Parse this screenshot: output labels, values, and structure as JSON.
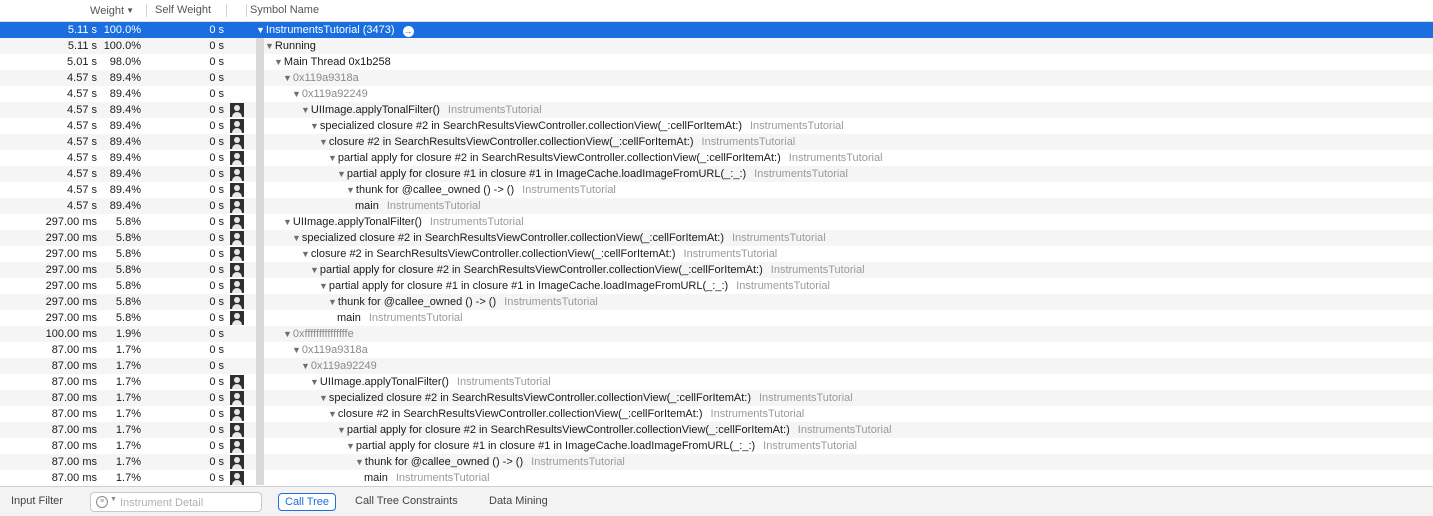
{
  "header": {
    "weight": "Weight",
    "self_weight": "Self Weight",
    "symbol_name": "Symbol Name"
  },
  "rows": [
    {
      "time": "5.11 s",
      "pct": "100.0%",
      "self": "0 s",
      "avatar": false,
      "depth": 0,
      "symbol": "InstrumentsTutorial (3473)",
      "lib": "",
      "expanded": true,
      "selected": true,
      "address": false,
      "go_icon": true
    },
    {
      "time": "5.11 s",
      "pct": "100.0%",
      "self": "0 s",
      "avatar": false,
      "depth": 1,
      "symbol": "Running",
      "lib": "",
      "expanded": true,
      "address": false
    },
    {
      "time": "5.01 s",
      "pct": "98.0%",
      "self": "0 s",
      "avatar": false,
      "depth": 2,
      "symbol": "Main Thread  0x1b258",
      "lib": "",
      "expanded": true,
      "address": false
    },
    {
      "time": "4.57 s",
      "pct": "89.4%",
      "self": "0 s",
      "avatar": false,
      "depth": 3,
      "symbol": "0x119a9318a",
      "lib": "",
      "expanded": true,
      "address": true
    },
    {
      "time": "4.57 s",
      "pct": "89.4%",
      "self": "0 s",
      "avatar": false,
      "depth": 4,
      "symbol": "0x119a92249",
      "lib": "",
      "expanded": true,
      "address": true
    },
    {
      "time": "4.57 s",
      "pct": "89.4%",
      "self": "0 s",
      "avatar": true,
      "depth": 5,
      "symbol": "UIImage.applyTonalFilter()",
      "lib": "InstrumentsTutorial",
      "expanded": true,
      "address": false
    },
    {
      "time": "4.57 s",
      "pct": "89.4%",
      "self": "0 s",
      "avatar": true,
      "depth": 6,
      "symbol": "specialized closure #2 in SearchResultsViewController.collectionView(_:cellForItemAt:)",
      "lib": "InstrumentsTutorial",
      "expanded": true,
      "address": false
    },
    {
      "time": "4.57 s",
      "pct": "89.4%",
      "self": "0 s",
      "avatar": true,
      "depth": 7,
      "symbol": "closure #2 in SearchResultsViewController.collectionView(_:cellForItemAt:)",
      "lib": "InstrumentsTutorial",
      "expanded": true,
      "address": false
    },
    {
      "time": "4.57 s",
      "pct": "89.4%",
      "self": "0 s",
      "avatar": true,
      "depth": 8,
      "symbol": "partial apply for closure #2 in SearchResultsViewController.collectionView(_:cellForItemAt:)",
      "lib": "InstrumentsTutorial",
      "expanded": true,
      "address": false
    },
    {
      "time": "4.57 s",
      "pct": "89.4%",
      "self": "0 s",
      "avatar": true,
      "depth": 9,
      "symbol": "partial apply for closure #1 in closure #1 in ImageCache.loadImageFromURL(_:_:)",
      "lib": "InstrumentsTutorial",
      "expanded": true,
      "address": false
    },
    {
      "time": "4.57 s",
      "pct": "89.4%",
      "self": "0 s",
      "avatar": true,
      "depth": 10,
      "symbol": "thunk for @callee_owned () -> ()",
      "lib": "InstrumentsTutorial",
      "expanded": true,
      "address": false
    },
    {
      "time": "4.57 s",
      "pct": "89.4%",
      "self": "0 s",
      "avatar": true,
      "depth": 11,
      "symbol": "main",
      "lib": "InstrumentsTutorial",
      "expanded": false,
      "address": false
    },
    {
      "time": "297.00 ms",
      "pct": "5.8%",
      "self": "0 s",
      "avatar": true,
      "depth": 3,
      "symbol": "UIImage.applyTonalFilter()",
      "lib": "InstrumentsTutorial",
      "expanded": true,
      "address": false
    },
    {
      "time": "297.00 ms",
      "pct": "5.8%",
      "self": "0 s",
      "avatar": true,
      "depth": 4,
      "symbol": "specialized closure #2 in SearchResultsViewController.collectionView(_:cellForItemAt:)",
      "lib": "InstrumentsTutorial",
      "expanded": true,
      "address": false
    },
    {
      "time": "297.00 ms",
      "pct": "5.8%",
      "self": "0 s",
      "avatar": true,
      "depth": 5,
      "symbol": "closure #2 in SearchResultsViewController.collectionView(_:cellForItemAt:)",
      "lib": "InstrumentsTutorial",
      "expanded": true,
      "address": false
    },
    {
      "time": "297.00 ms",
      "pct": "5.8%",
      "self": "0 s",
      "avatar": true,
      "depth": 6,
      "symbol": "partial apply for closure #2 in SearchResultsViewController.collectionView(_:cellForItemAt:)",
      "lib": "InstrumentsTutorial",
      "expanded": true,
      "address": false
    },
    {
      "time": "297.00 ms",
      "pct": "5.8%",
      "self": "0 s",
      "avatar": true,
      "depth": 7,
      "symbol": "partial apply for closure #1 in closure #1 in ImageCache.loadImageFromURL(_:_:)",
      "lib": "InstrumentsTutorial",
      "expanded": true,
      "address": false
    },
    {
      "time": "297.00 ms",
      "pct": "5.8%",
      "self": "0 s",
      "avatar": true,
      "depth": 8,
      "symbol": "thunk for @callee_owned () -> ()",
      "lib": "InstrumentsTutorial",
      "expanded": true,
      "address": false
    },
    {
      "time": "297.00 ms",
      "pct": "5.8%",
      "self": "0 s",
      "avatar": true,
      "depth": 9,
      "symbol": "main",
      "lib": "InstrumentsTutorial",
      "expanded": false,
      "address": false
    },
    {
      "time": "100.00 ms",
      "pct": "1.9%",
      "self": "0 s",
      "avatar": false,
      "depth": 3,
      "symbol": "0xfffffffffffffffe",
      "lib": "",
      "expanded": true,
      "address": true
    },
    {
      "time": "87.00 ms",
      "pct": "1.7%",
      "self": "0 s",
      "avatar": false,
      "depth": 4,
      "symbol": "0x119a9318a",
      "lib": "",
      "expanded": true,
      "address": true
    },
    {
      "time": "87.00 ms",
      "pct": "1.7%",
      "self": "0 s",
      "avatar": false,
      "depth": 5,
      "symbol": "0x119a92249",
      "lib": "",
      "expanded": true,
      "address": true
    },
    {
      "time": "87.00 ms",
      "pct": "1.7%",
      "self": "0 s",
      "avatar": true,
      "depth": 6,
      "symbol": "UIImage.applyTonalFilter()",
      "lib": "InstrumentsTutorial",
      "expanded": true,
      "address": false
    },
    {
      "time": "87.00 ms",
      "pct": "1.7%",
      "self": "0 s",
      "avatar": true,
      "depth": 7,
      "symbol": "specialized closure #2 in SearchResultsViewController.collectionView(_:cellForItemAt:)",
      "lib": "InstrumentsTutorial",
      "expanded": true,
      "address": false
    },
    {
      "time": "87.00 ms",
      "pct": "1.7%",
      "self": "0 s",
      "avatar": true,
      "depth": 8,
      "symbol": "closure #2 in SearchResultsViewController.collectionView(_:cellForItemAt:)",
      "lib": "InstrumentsTutorial",
      "expanded": true,
      "address": false
    },
    {
      "time": "87.00 ms",
      "pct": "1.7%",
      "self": "0 s",
      "avatar": true,
      "depth": 9,
      "symbol": "partial apply for closure #2 in SearchResultsViewController.collectionView(_:cellForItemAt:)",
      "lib": "InstrumentsTutorial",
      "expanded": true,
      "address": false
    },
    {
      "time": "87.00 ms",
      "pct": "1.7%",
      "self": "0 s",
      "avatar": true,
      "depth": 10,
      "symbol": "partial apply for closure #1 in closure #1 in ImageCache.loadImageFromURL(_:_:)",
      "lib": "InstrumentsTutorial",
      "expanded": true,
      "address": false
    },
    {
      "time": "87.00 ms",
      "pct": "1.7%",
      "self": "0 s",
      "avatar": true,
      "depth": 11,
      "symbol": "thunk for @callee_owned () -> ()",
      "lib": "InstrumentsTutorial",
      "expanded": true,
      "address": false
    },
    {
      "time": "87.00 ms",
      "pct": "1.7%",
      "self": "0 s",
      "avatar": true,
      "depth": 12,
      "symbol": "main",
      "lib": "InstrumentsTutorial",
      "expanded": false,
      "address": false
    }
  ],
  "icons": {
    "row_avatar": "user-icon",
    "go_arrow": "arrow-circle-right-icon",
    "disclosure": "disclosure-triangle-icon",
    "filter": "filter-icon"
  },
  "footer": {
    "input_filter_label": "Input Filter",
    "search_placeholder": "Instrument Detail",
    "search_value": "",
    "tabs": [
      "Call Tree",
      "Call Tree Constraints",
      "Data Mining"
    ],
    "active_tab": "Call Tree"
  },
  "colors": {
    "selection": "#1a6ee0",
    "library_text": "#9a9a9a",
    "address_text": "#8a8a8a"
  }
}
